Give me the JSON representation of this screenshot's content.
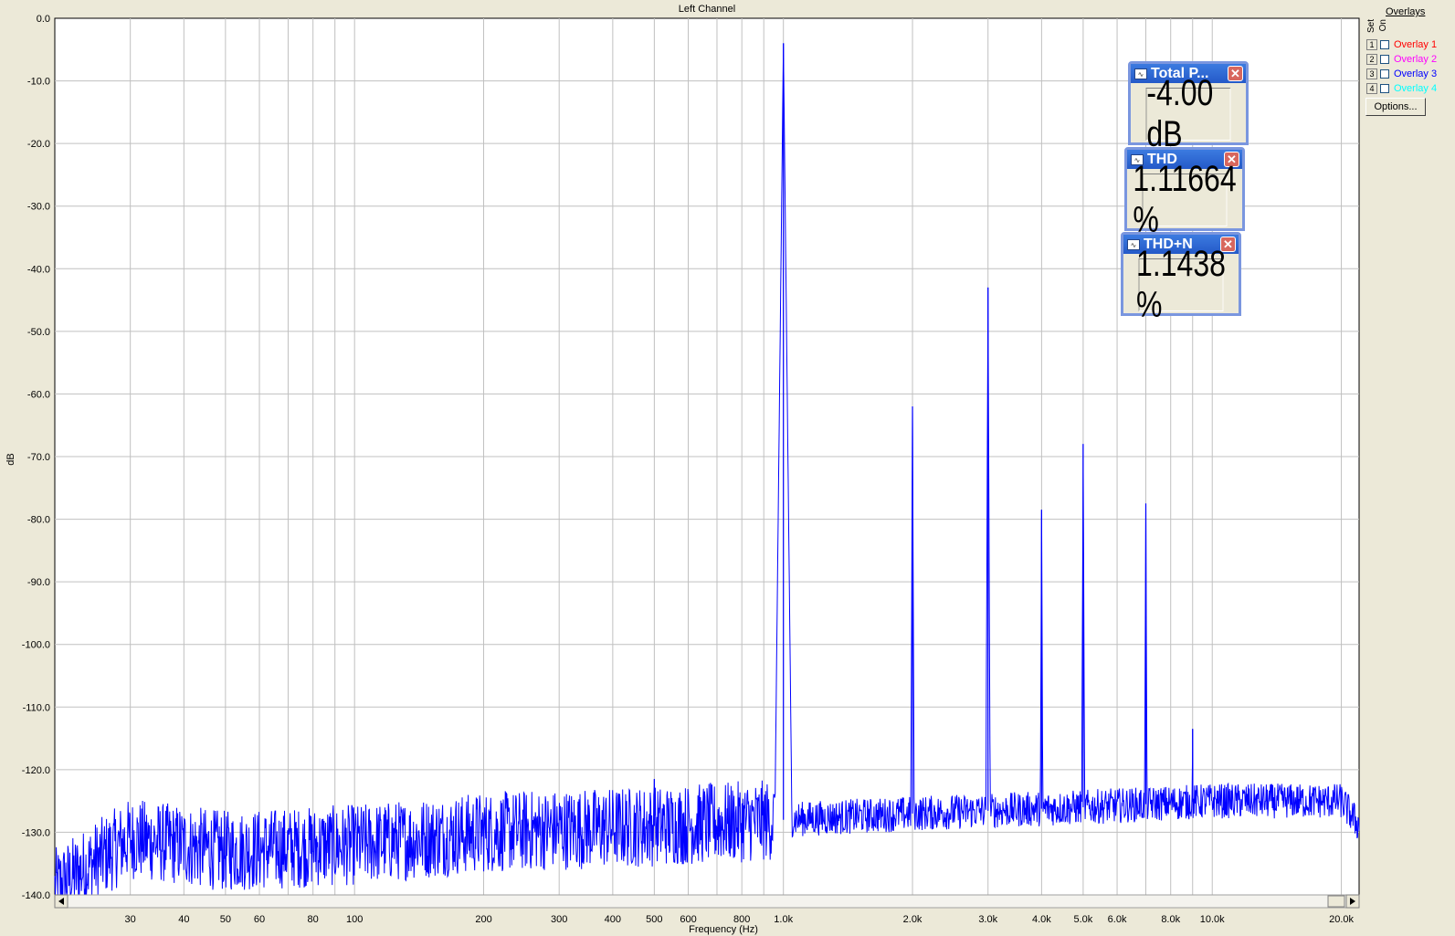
{
  "chart_data": {
    "type": "line",
    "title": "Left Channel",
    "xlabel": "Frequency (Hz)",
    "ylabel": "dB",
    "x_scale": "log",
    "xlim": [
      20,
      22000
    ],
    "ylim": [
      -140,
      0
    ],
    "grid": true,
    "y_ticks": [
      "0.0",
      "-10.0",
      "-20.0",
      "-30.0",
      "-40.0",
      "-50.0",
      "-60.0",
      "-70.0",
      "-80.0",
      "-90.0",
      "-100.0",
      "-110.0",
      "-120.0",
      "-130.0",
      "-140.0"
    ],
    "x_ticks": [
      {
        "value": 30,
        "label": "30"
      },
      {
        "value": 40,
        "label": "40"
      },
      {
        "value": 50,
        "label": "50"
      },
      {
        "value": 60,
        "label": "60"
      },
      {
        "value": 80,
        "label": "80"
      },
      {
        "value": 100,
        "label": "100"
      },
      {
        "value": 200,
        "label": "200"
      },
      {
        "value": 300,
        "label": "300"
      },
      {
        "value": 400,
        "label": "400"
      },
      {
        "value": 500,
        "label": "500"
      },
      {
        "value": 600,
        "label": "600"
      },
      {
        "value": 800,
        "label": "800"
      },
      {
        "value": 1000,
        "label": "1.0k"
      },
      {
        "value": 2000,
        "label": "2.0k"
      },
      {
        "value": 3000,
        "label": "3.0k"
      },
      {
        "value": 4000,
        "label": "4.0k"
      },
      {
        "value": 5000,
        "label": "5.0k"
      },
      {
        "value": 6000,
        "label": "6.0k"
      },
      {
        "value": 8000,
        "label": "8.0k"
      },
      {
        "value": 10000,
        "label": "10.0k"
      },
      {
        "value": 20000,
        "label": "20.0k"
      }
    ],
    "series": [
      {
        "color": "#0000ff",
        "noise_floor_db": [
          [
            20,
            -139
          ],
          [
            30,
            -131
          ],
          [
            50,
            -133
          ],
          [
            100,
            -132
          ],
          [
            200,
            -130
          ],
          [
            500,
            -129
          ],
          [
            1000,
            -128
          ],
          [
            2000,
            -127
          ],
          [
            5000,
            -126
          ],
          [
            10000,
            -125
          ],
          [
            20000,
            -125
          ],
          [
            22000,
            -129
          ]
        ],
        "peaks": [
          {
            "x": 1000,
            "y": -4.0
          },
          {
            "x": 2000,
            "y": -62.0
          },
          {
            "x": 3000,
            "y": -43.0
          },
          {
            "x": 4000,
            "y": -78.5
          },
          {
            "x": 5000,
            "y": -68.0
          },
          {
            "x": 7000,
            "y": -77.5
          },
          {
            "x": 9000,
            "y": -113.5
          },
          {
            "x": 500,
            "y": -121.5
          }
        ]
      }
    ]
  },
  "overlays": {
    "title": "Overlays",
    "set_label": "Set",
    "on_label": "On",
    "items": [
      {
        "num": "1",
        "label": "Overlay 1",
        "color": "#ff0000"
      },
      {
        "num": "2",
        "label": "Overlay 2",
        "color": "#ff00ff"
      },
      {
        "num": "3",
        "label": "Overlay 3",
        "color": "#0000ff"
      },
      {
        "num": "4",
        "label": "Overlay 4",
        "color": "#00ffff"
      }
    ],
    "options_label": "Options..."
  },
  "meters": [
    {
      "title": "Total P...",
      "value": "-4.00 dB"
    },
    {
      "title": "THD",
      "value": "1.11664 %"
    },
    {
      "title": "THD+N",
      "value": "1.1438 %"
    }
  ]
}
